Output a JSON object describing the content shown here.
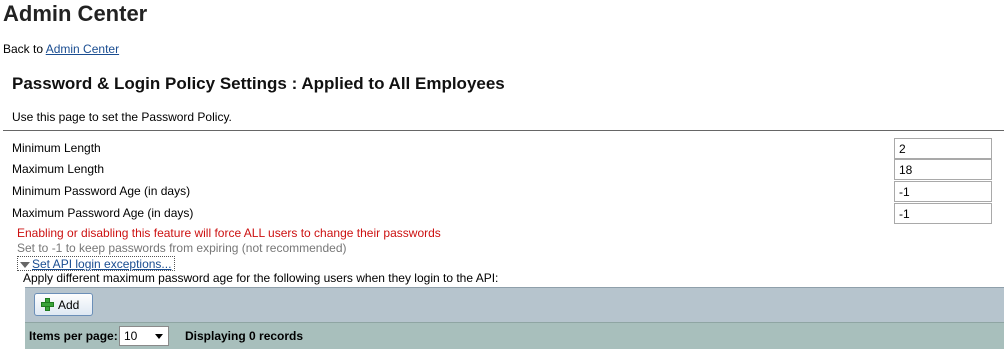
{
  "header": {
    "title": "Admin Center"
  },
  "back_link": {
    "prefix": "Back to ",
    "label": "Admin Center"
  },
  "section": {
    "title": "Password & Login Policy Settings : Applied to All Employees",
    "description": "Use this page to set the Password Policy."
  },
  "fields": [
    {
      "label": "Minimum Length",
      "value": "2"
    },
    {
      "label": "Maximum Length",
      "value": "18"
    },
    {
      "label": "Minimum Password Age (in days)",
      "value": "-1"
    },
    {
      "label": "Maximum Password Age (in days)",
      "value": "-1"
    }
  ],
  "warning": "Enabling or disabling this feature will force ALL users to change their passwords",
  "hint": "Set to -1 to keep passwords from expiring (not recommended)",
  "api_exceptions": {
    "toggle_label": "Set API login exceptions...",
    "description": "Apply different maximum password age for the following users when they login to the API:",
    "add_label": "Add",
    "items_per_page_label": "Items per page:",
    "items_per_page_value": "10",
    "records_label": "Displaying 0 records"
  },
  "icons": {
    "add": "plus-icon",
    "toggle": "triangle-down-icon",
    "select": "chevron-down-icon"
  },
  "colors": {
    "link": "#1a4d91",
    "warning": "#cc1111",
    "toolbar_bg": "#b6c4cd",
    "pager_bg": "#a8bfbc"
  }
}
